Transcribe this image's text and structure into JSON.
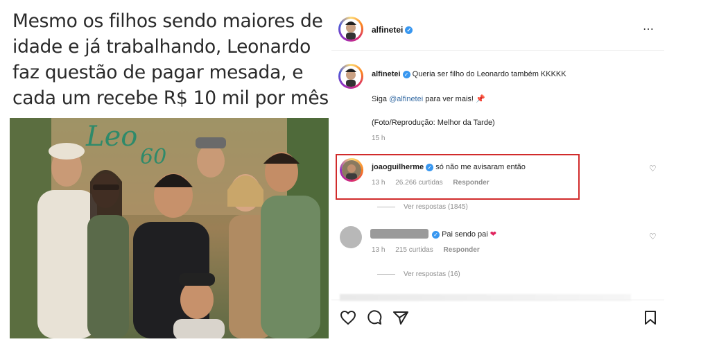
{
  "headline": {
    "line1": "Mesmo os filhos sendo maiores de",
    "line2": "idade e já trabalhando, Leonardo",
    "line3": "faz questão de pagar mesada, e",
    "line4": "cada um recebe R$ 10 mil por mês"
  },
  "photo": {
    "sign_text": "Leo",
    "sign_number": "60"
  },
  "post": {
    "account": "alfinetei",
    "more_icon": "⋯",
    "caption": {
      "author": "alfinetei",
      "text": "Queria ser filho do Leonardo também KKKKK",
      "follow_prefix": "Siga",
      "follow_mention": "@alfinetei",
      "follow_suffix": "para ver mais!",
      "pin": "📌",
      "credit": "(Foto/Reprodução: Melhor da Tarde)",
      "time": "15 h"
    },
    "comments": [
      {
        "author": "joaoguilherme",
        "text": "só não me avisaram então",
        "time": "13 h",
        "likes": "26.266 curtidas",
        "reply": "Responder",
        "view_replies": "Ver respostas (1845)"
      },
      {
        "author": "",
        "text": "Pai sendo pai",
        "emoji": "❤",
        "time": "13 h",
        "likes": "215 curtidas",
        "reply": "Responder",
        "view_replies": "Ver respostas (16)"
      }
    ],
    "actions": {
      "like": "heart-icon",
      "comment": "comment-icon",
      "share": "send-icon",
      "save": "bookmark-icon"
    }
  },
  "colors": {
    "verified": "#3897f0",
    "highlight": "#d12b2b",
    "mention": "#3a6ea5",
    "heart_emoji": "#e0245e"
  }
}
